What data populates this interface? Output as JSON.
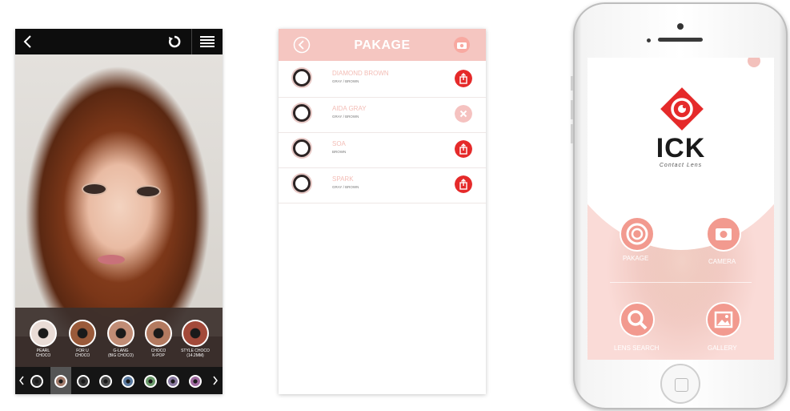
{
  "camera_screen": {
    "back_icon": "chevron-left-icon",
    "refresh_icon": "refresh-icon",
    "menu_icon": "hamburger-menu-icon",
    "lenses": [
      {
        "line1": "PEARL",
        "line2": "CHOCO",
        "color": "#e9dcd6"
      },
      {
        "line1": "FOR U",
        "line2": "CHOCO",
        "color": "#9a5a3a"
      },
      {
        "line1": "G-LANG",
        "line2": "(BIG CHOCO)",
        "color": "#c08c75"
      },
      {
        "line1": "CHOCO",
        "line2": "K-POP",
        "color": "#b37a60"
      },
      {
        "line1": "STYLE CHOCO",
        "line2": "(14.2MM)",
        "color": "#a34a3a"
      }
    ],
    "strip_colors": [
      "#2d2d2d",
      "#a07a6a",
      "#3a3a3a",
      "#4a4a4a",
      "#5a7aa0",
      "#6a9a6a",
      "#8a7aa0",
      "#a06aa0"
    ]
  },
  "package_screen": {
    "title": "PAKAGE",
    "items": [
      {
        "name": "DIAMOND BROWN",
        "sub": "GRAY / BROWN",
        "action": "share-icon",
        "action_color": "#e52a2a"
      },
      {
        "name": "AIDA GRAY",
        "sub": "GRAY / BROWN",
        "action": "close-icon",
        "action_color": "#f5c2c0"
      },
      {
        "name": "SOA",
        "sub": "BROWN",
        "action": "share-icon",
        "action_color": "#e52a2a"
      },
      {
        "name": "SPARK",
        "sub": "GRAY / BROWN",
        "action": "share-icon",
        "action_color": "#e52a2a"
      }
    ]
  },
  "home_screen": {
    "brand": "ICK",
    "tagline": "Contact Lens",
    "menu": {
      "pakage": "PAKAGE",
      "camera": "CAMERA",
      "lens_search": "LENS SEARCH",
      "gallery": "GALLERY"
    }
  },
  "colors": {
    "accent_pink": "#f5c6c1",
    "brand_red": "#e52a2a"
  }
}
